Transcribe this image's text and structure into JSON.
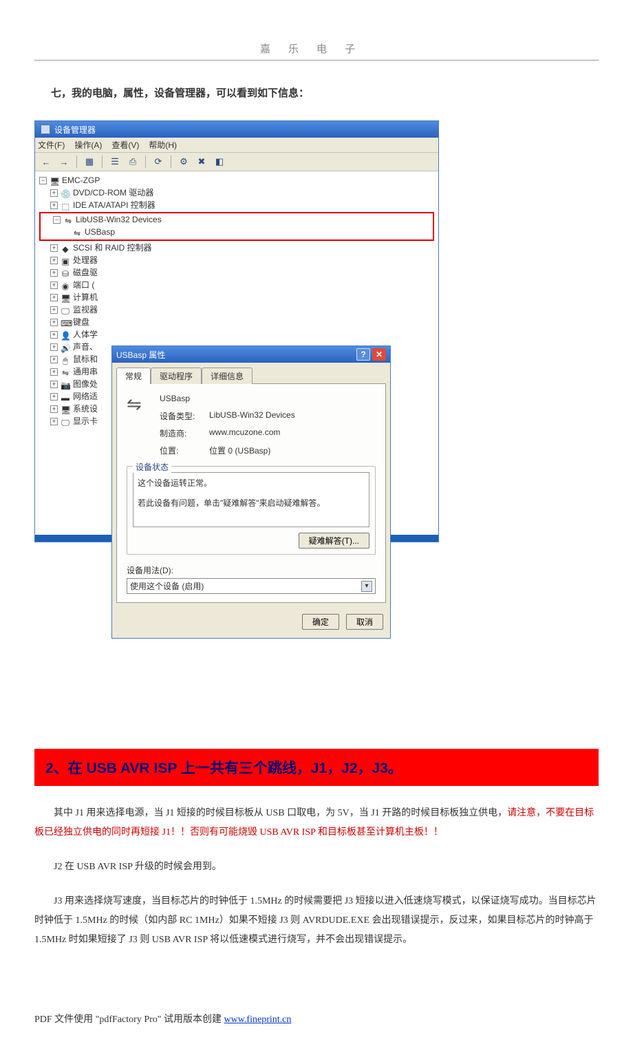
{
  "header": "嘉乐电子",
  "section_intro": "七，我的电脑，属性，设备管理器，可以看到如下信息：",
  "device_manager": {
    "title": "设备管理器",
    "menus": {
      "file": "文件(F)",
      "action": "操作(A)",
      "view": "查看(V)",
      "help": "帮助(H)"
    },
    "root": "EMC-ZGP",
    "nodes": {
      "dvd": "DVD/CD-ROM 驱动器",
      "ide": "IDE ATA/ATAPI 控制器",
      "libusb": "LibUSB-Win32 Devices",
      "usbasp": "USBasp",
      "scsi": "SCSI 和 RAID 控制器",
      "cpu": "处理器",
      "disk": "磁盘驱",
      "port": "端口 (",
      "computer": "计算机",
      "monitor": "监视器",
      "keyboard": "键盘",
      "hid": "人体学",
      "sound": "声音、",
      "mouse": "鼠标和",
      "usb": "通用串",
      "image": "图像处",
      "network": "网络适",
      "system": "系统设",
      "display": "显示卡"
    }
  },
  "properties": {
    "title": "USBasp 属性",
    "tabs": {
      "general": "常规",
      "driver": "驱动程序",
      "details": "详细信息"
    },
    "device_name": "USBasp",
    "rows": {
      "type_label": "设备类型:",
      "type_value": "LibUSB-Win32 Devices",
      "mfr_label": "制造商:",
      "mfr_value": "www.mcuzone.com",
      "loc_label": "位置:",
      "loc_value": "位置 0 (USBasp)"
    },
    "status_title": "设备状态",
    "status_line1": "这个设备运转正常。",
    "status_line2": "若此设备有问题，单击\"疑难解答\"来启动疑难解答。",
    "troubleshoot_btn": "疑难解答(T)...",
    "usage_label": "设备用法(D):",
    "usage_value": "使用这个设备 (启用)",
    "ok_btn": "确定",
    "cancel_btn": "取消"
  },
  "banner": "2、在 USB AVR ISP 上一共有三个跳线，J1，J2，J3。",
  "paragraphs": {
    "p1a": "其中 J1 用来选择电源，当 J1 短接的时候目标板从 USB 口取电，为 5V，当 J1 开路的时候目标板独立供电，",
    "p1b_warn": "请注意，不要在目标板已经独立供电的同时再短接 J1！！否则有可能烧毁 USB AVR ISP 和目标板甚至计算机主板！！",
    "p2": "J2 在 USB AVR ISP 升级的时候会用到。",
    "p3": "J3 用来选择烧写速度，当目标芯片的时钟低于 1.5MHz 的时候需要把 J3 短接以进入低速烧写模式，以保证烧写成功。当目标芯片时钟低于 1.5MHz 的时候（如内部 RC 1MHz）如果不短接 J3 则 AVRDUDE.EXE 会出现错误提示，反过来，如果目标芯片的时钟高于 1.5MHz 时如果短接了 J3 则 USB AVR ISP 将以低速模式进行烧写，并不会出现错误提示。"
  },
  "footer": {
    "text": "PDF 文件使用 \"pdfFactory Pro\" 试用版本创建 ",
    "link_text": "www.fineprint.cn"
  }
}
